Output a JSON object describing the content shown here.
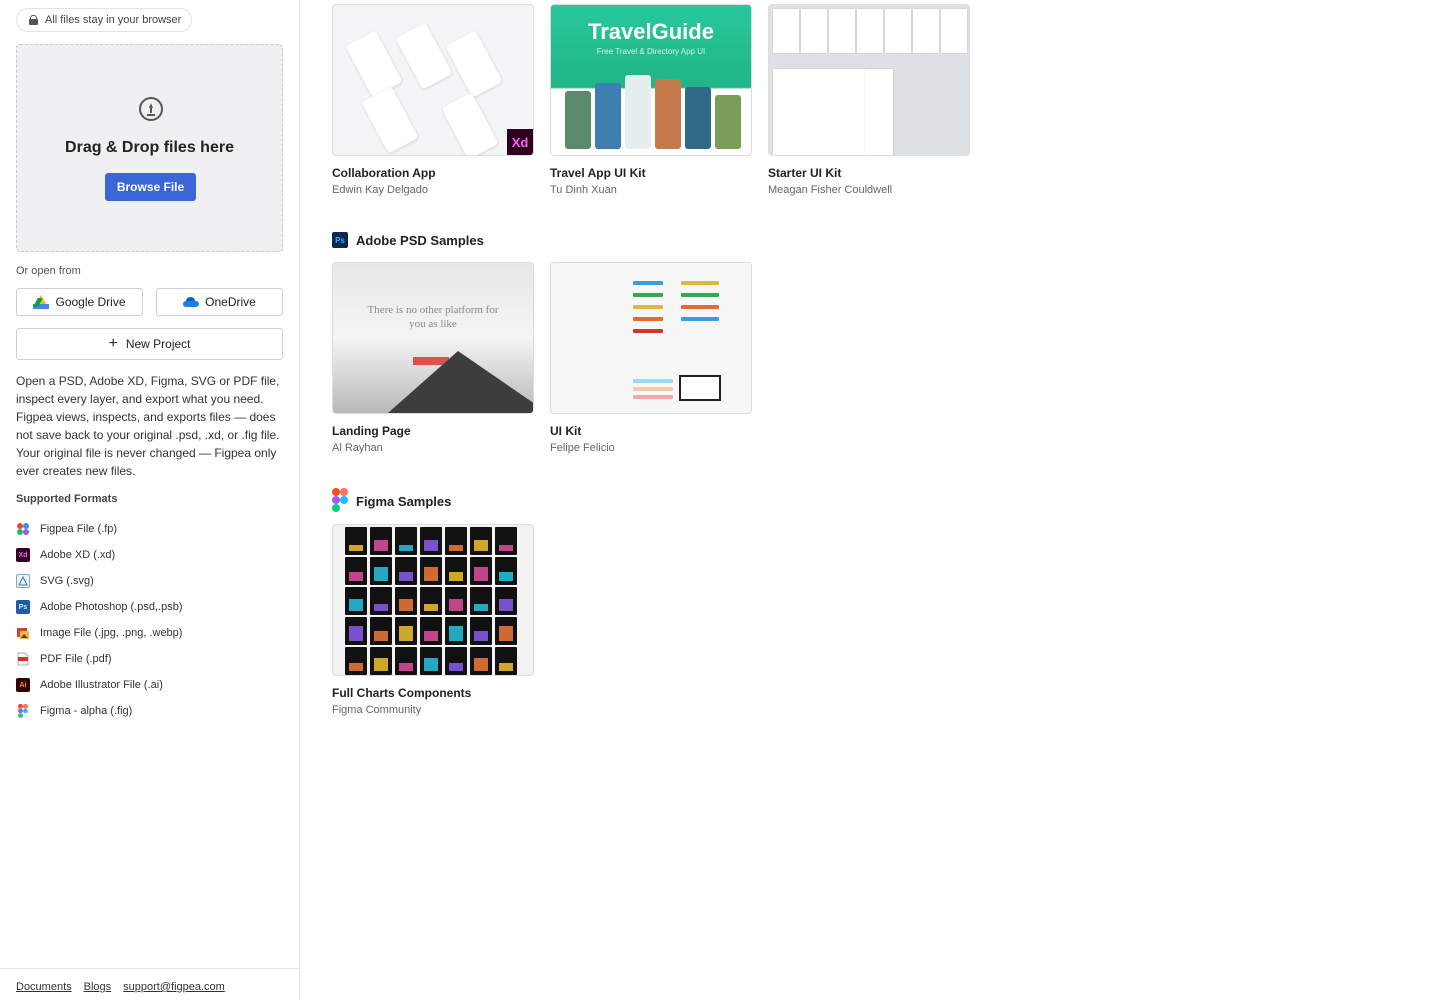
{
  "sidebar": {
    "privacy_note": "All files stay in your browser",
    "dropzone": {
      "title": "Drag & Drop files here",
      "browse_label": "Browse File"
    },
    "open_from_label": "Or open from",
    "google_drive_label": "Google Drive",
    "onedrive_label": "OneDrive",
    "new_project_label": "New Project",
    "description": "Open a PSD, Adobe XD, Figma, SVG or PDF file, inspect every layer, and export what you need. Figpea views, inspects, and exports files — does not save back to your original .psd, .xd, or .fig file. Your original file is never changed — Figpea only ever creates new files.",
    "formats_title": "Supported Formats",
    "formats": [
      {
        "label": "Figpea File (.fp)",
        "icon": "figpea-icon"
      },
      {
        "label": "Adobe XD (.xd)",
        "icon": "adobe-xd-icon"
      },
      {
        "label": "SVG (.svg)",
        "icon": "svg-icon"
      },
      {
        "label": "Adobe Photoshop (.psd,.psb)",
        "icon": "photoshop-icon"
      },
      {
        "label": "Image File (.jpg, .png, .webp)",
        "icon": "image-icon"
      },
      {
        "label": "PDF File (.pdf)",
        "icon": "pdf-icon"
      },
      {
        "label": "Adobe Illustrator File (.ai)",
        "icon": "illustrator-icon"
      },
      {
        "label": "Figma - alpha (.fig)",
        "icon": "figma-icon"
      }
    ],
    "footer_links": [
      "Documents",
      "Blogs",
      "support@figpea.com"
    ]
  },
  "main": {
    "xd_cards": [
      {
        "title": "Collaboration App",
        "author": "Edwin Kay Delgado"
      },
      {
        "title": "Travel App UI Kit",
        "author": "Tu Dinh Xuan"
      },
      {
        "title": "Starter UI Kit",
        "author": "Meagan Fisher Couldwell"
      }
    ],
    "psd_section": {
      "title": "Adobe PSD Samples",
      "cards": [
        {
          "title": "Landing Page",
          "author": "Al Rayhan"
        },
        {
          "title": "UI Kit",
          "author": "Felipe Felicio"
        }
      ]
    },
    "figma_section": {
      "title": "Figma Samples",
      "cards": [
        {
          "title": "Full Charts Components",
          "author": "Figma Community"
        }
      ]
    },
    "thumb_text": {
      "xd_badge": "Xd",
      "travel_logo": "TravelGuide",
      "travel_sub": "Free Travel & Directory App UI",
      "landing_text": "There is no other platform for you as like"
    }
  },
  "colors": {
    "accent": "#3a66d6",
    "xd_bg": "#2e001f",
    "xd_fg": "#ff61f6",
    "ps_bg": "#0b2a4a",
    "ps_fg": "#31a8ff"
  }
}
